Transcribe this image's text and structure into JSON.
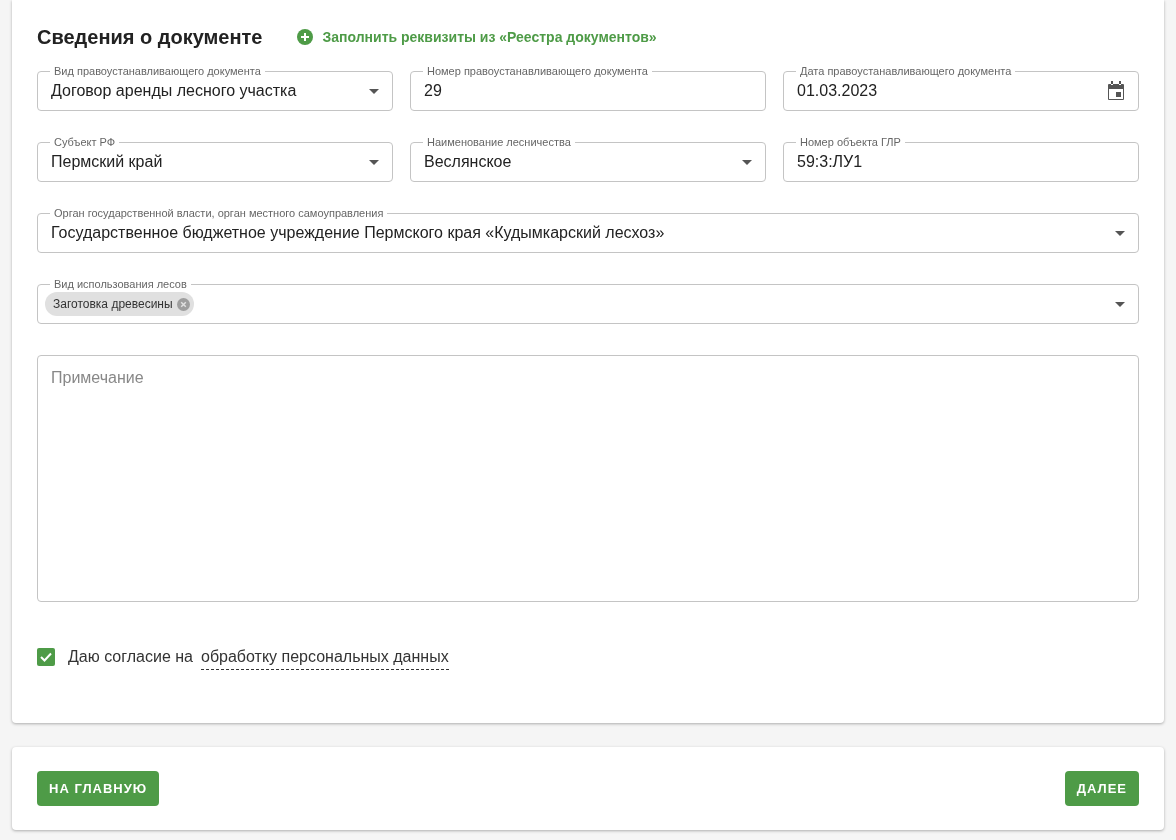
{
  "document_section": {
    "title": "Сведения о документе",
    "fill_link": "Заполнить реквизиты из «Реестра документов»"
  },
  "field_rows": [
    [
      {
        "kind": "select",
        "label": "Вид правоустанавливающего документа",
        "value": "Договор аренды лесного участка"
      },
      {
        "kind": "text",
        "label": "Номер правоустанавливающего документа",
        "value": "29"
      },
      {
        "kind": "date",
        "label": "Дата правоустанавливающего документа",
        "value": "01.03.2023"
      }
    ],
    [
      {
        "kind": "select",
        "label": "Субъект РФ",
        "value": "Пермский край"
      },
      {
        "kind": "select",
        "label": "Наименование лесничества",
        "value": "Веслянское"
      },
      {
        "kind": "text",
        "label": "Номер объекта ГЛР",
        "value": "59:3:ЛУ1"
      }
    ],
    [
      {
        "kind": "select",
        "label": "Орган государственной власти, орган местного самоуправления",
        "value": "Государственное бюджетное учреждение Пермского края «Кудымкарский лесхоз»"
      }
    ],
    [
      {
        "kind": "chips",
        "label": "Вид использования лесов",
        "chips": [
          "Заготовка древесины"
        ]
      }
    ]
  ],
  "note": {
    "placeholder": "Примечание"
  },
  "consent": {
    "checked": true,
    "text": "Даю согласие на",
    "link": "обработку персональных данных"
  },
  "buttons": {
    "home": "НА ГЛАВНУЮ",
    "next": "ДАЛЕЕ"
  }
}
